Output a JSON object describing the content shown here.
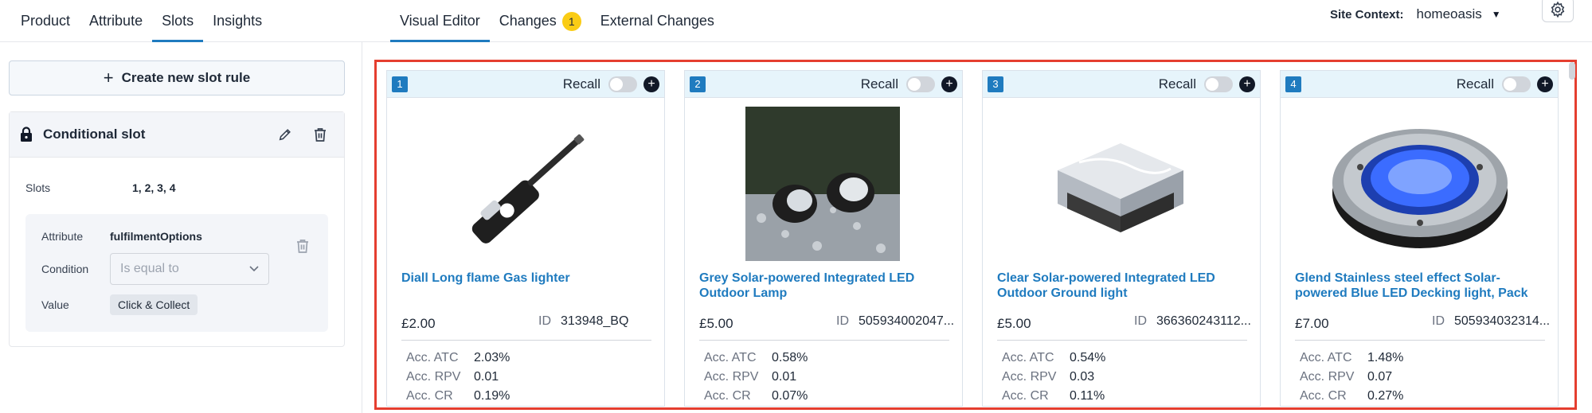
{
  "topbar": {
    "left_tabs": [
      {
        "label": "Product",
        "active": false
      },
      {
        "label": "Attribute",
        "active": false
      },
      {
        "label": "Slots",
        "active": true
      },
      {
        "label": "Insights",
        "active": false
      }
    ],
    "center_tabs": {
      "visual_editor": "Visual Editor",
      "changes": "Changes",
      "changes_count": "1",
      "external_changes": "External Changes"
    },
    "site_context_label": "Site Context:",
    "site_context_value": "homeoasis"
  },
  "sidebar": {
    "create_label": "Create new slot rule",
    "slot_title": "Conditional slot",
    "slots_label": "Slots",
    "slots_value": "1, 2, 3, 4",
    "condition": {
      "attribute_label": "Attribute",
      "attribute_value": "fulfilmentOptions",
      "condition_label": "Condition",
      "condition_placeholder": "Is equal to",
      "value_label": "Value",
      "value_chip": "Click & Collect"
    }
  },
  "recall_label": "Recall",
  "metric_labels": {
    "atc": "Acc. ATC",
    "rpv": "Acc. RPV",
    "cr": "Acc. CR"
  },
  "id_label": "ID",
  "cards": [
    {
      "num": "1",
      "title": "Diall Long flame Gas lighter",
      "price": "£2.00",
      "id": "313948_BQ",
      "atc": "2.03%",
      "rpv": "0.01",
      "cr": "0.19%"
    },
    {
      "num": "2",
      "title": "Grey Solar-powered Integrated LED Outdoor Lamp",
      "price": "£5.00",
      "id": "505934002047...",
      "atc": "0.58%",
      "rpv": "0.01",
      "cr": "0.07%"
    },
    {
      "num": "3",
      "title": "Clear Solar-powered Integrated LED Outdoor Ground light",
      "price": "£5.00",
      "id": "366360243112...",
      "atc": "0.54%",
      "rpv": "0.03",
      "cr": "0.11%"
    },
    {
      "num": "4",
      "title": "Glend Stainless steel effect Solar-powered Blue LED Decking light, Pack",
      "price": "£7.00",
      "id": "505934032314...",
      "atc": "1.48%",
      "rpv": "0.07",
      "cr": "0.27%"
    }
  ]
}
